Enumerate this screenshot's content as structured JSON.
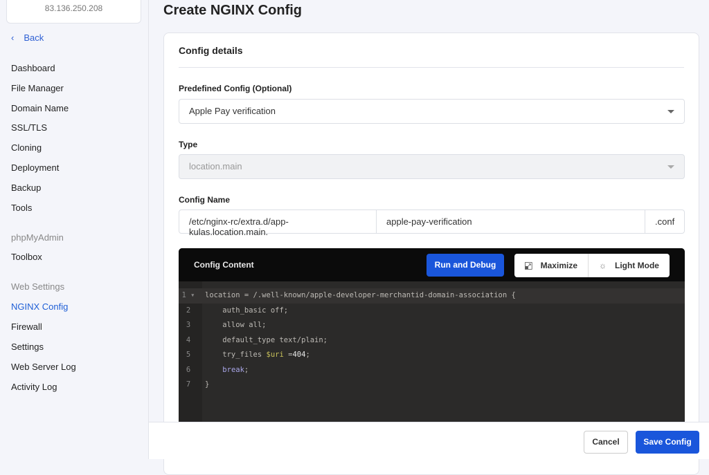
{
  "sidebar": {
    "server_ip": "83.136.250.208",
    "back": "Back",
    "items": [
      "Dashboard",
      "File Manager",
      "Domain Name",
      "SSL/TLS",
      "Cloning",
      "Deployment",
      "Backup",
      "Tools"
    ],
    "phpmyadmin_header": "phpMyAdmin",
    "toolbox": "Toolbox",
    "web_settings_header": "Web Settings",
    "web_items": [
      "NGINX Config",
      "Firewall",
      "Settings",
      "Web Server Log",
      "Activity Log"
    ]
  },
  "page": {
    "title": "Create NGINX Config"
  },
  "form": {
    "section_title": "Config details",
    "predefined_label": "Predefined Config (Optional)",
    "predefined_value": "Apple Pay verification",
    "type_label": "Type",
    "type_value": "location.main",
    "name_label": "Config Name",
    "name_prefix": "/etc/nginx-rc/extra.d/app-kulas.location.main.",
    "name_value": "apple-pay-verification",
    "name_suffix": ".conf"
  },
  "editor": {
    "title": "Config Content",
    "run": "Run and Debug",
    "maximize": "Maximize",
    "light_mode": "Light Mode",
    "lines": [
      "location = /.well-known/apple-developer-merchantid-domain-association {",
      "    auth_basic off;",
      "    allow all;",
      "    default_type text/plain;",
      "    try_files ",
      "    break;",
      "}"
    ],
    "line5_var": "$uri",
    "line5_eq": " =",
    "line5_num": "404",
    "line5_end": ";",
    "line6_kw": "break"
  },
  "footer": {
    "cancel": "Cancel",
    "save": "Save Config"
  },
  "colors": {
    "primary": "#1a56db",
    "active_nav": "#1f5fd6"
  }
}
